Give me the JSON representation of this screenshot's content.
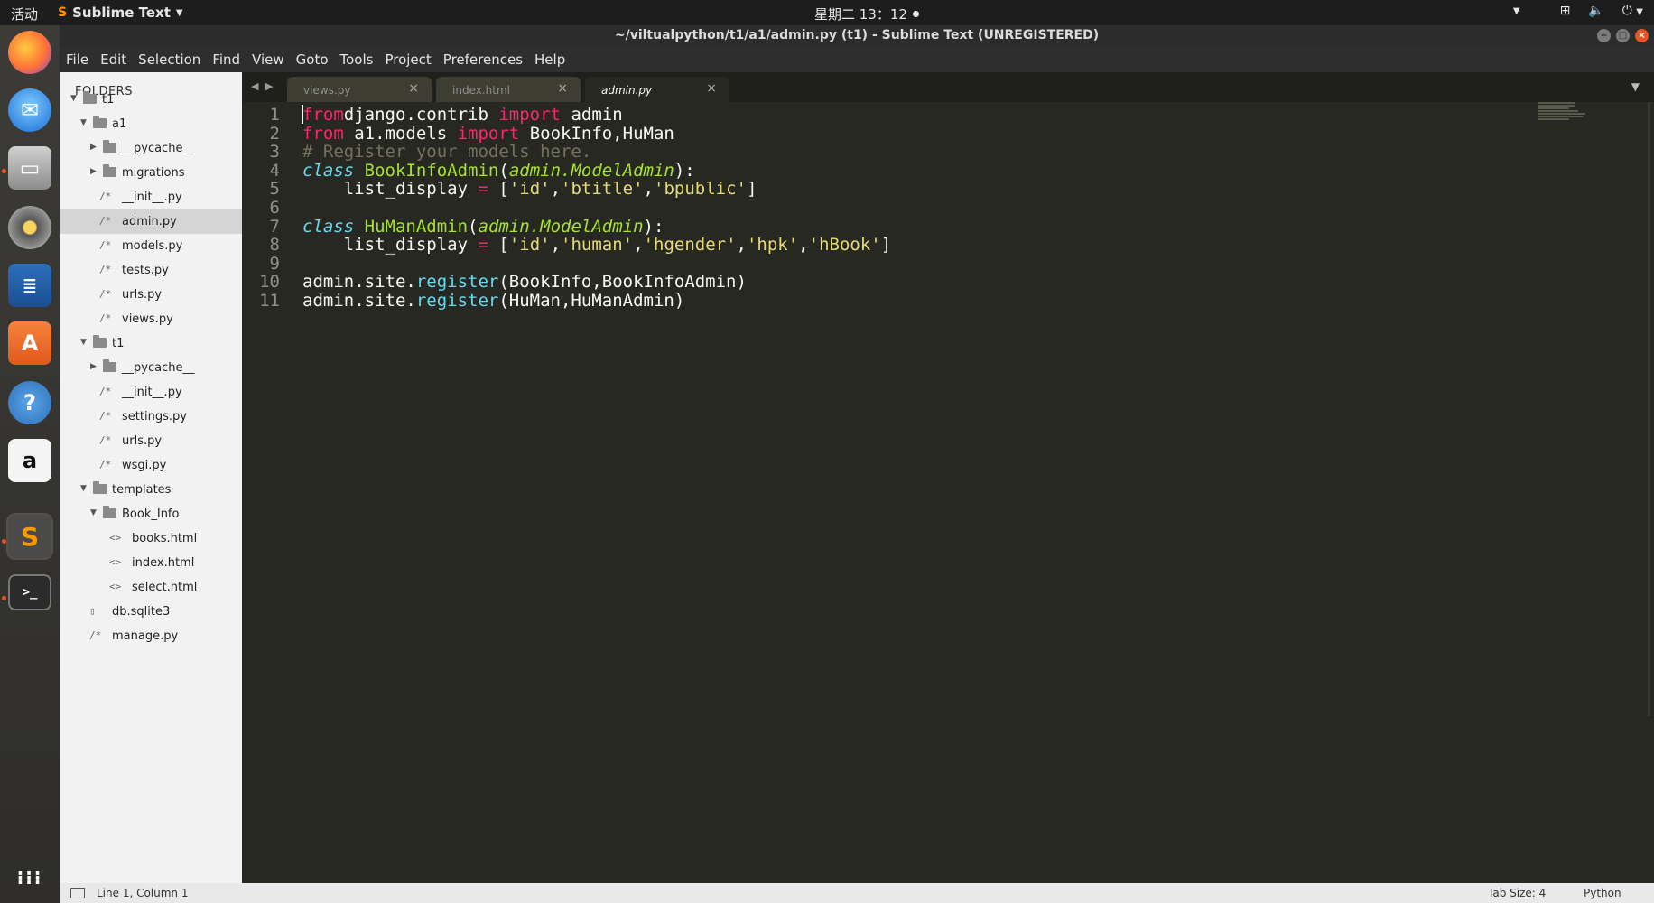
{
  "topbar": {
    "activities": "活动",
    "app_name": "Sublime Text",
    "clock": "星期二 13：12"
  },
  "dock": {
    "items": [
      "firefox-icon",
      "thunderbird-icon",
      "files-icon",
      "rhythmbox-icon",
      "writer-icon",
      "software-icon",
      "help-icon",
      "amazon-icon",
      "sublime-icon",
      "terminal-icon",
      "app-grid-icon"
    ]
  },
  "window": {
    "title": "~/viltualpython/t1/a1/admin.py (t1) - Sublime Text (UNREGISTERED)"
  },
  "menu": {
    "items": [
      "File",
      "Edit",
      "Selection",
      "Find",
      "View",
      "Goto",
      "Tools",
      "Project",
      "Preferences",
      "Help"
    ]
  },
  "sidebar": {
    "header": "FOLDERS",
    "tree": [
      {
        "label": "t1",
        "kind": "folder-open",
        "depth": 0
      },
      {
        "label": "a1",
        "kind": "folder-open",
        "depth": 1
      },
      {
        "label": "__pycache__",
        "kind": "folder",
        "depth": 2
      },
      {
        "label": "migrations",
        "kind": "folder",
        "depth": 2
      },
      {
        "label": "__init__.py",
        "kind": "py",
        "depth": 2
      },
      {
        "label": "admin.py",
        "kind": "py",
        "depth": 2,
        "selected": true
      },
      {
        "label": "models.py",
        "kind": "py",
        "depth": 2
      },
      {
        "label": "tests.py",
        "kind": "py",
        "depth": 2
      },
      {
        "label": "urls.py",
        "kind": "py",
        "depth": 2
      },
      {
        "label": "views.py",
        "kind": "py",
        "depth": 2
      },
      {
        "label": "t1",
        "kind": "folder-open",
        "depth": 1
      },
      {
        "label": "__pycache__",
        "kind": "folder",
        "depth": 2
      },
      {
        "label": "__init__.py",
        "kind": "py",
        "depth": 2
      },
      {
        "label": "settings.py",
        "kind": "py",
        "depth": 2
      },
      {
        "label": "urls.py",
        "kind": "py",
        "depth": 2
      },
      {
        "label": "wsgi.py",
        "kind": "py",
        "depth": 2
      },
      {
        "label": "templates",
        "kind": "folder-open",
        "depth": 1
      },
      {
        "label": "Book_Info",
        "kind": "folder-open",
        "depth": 2
      },
      {
        "label": "books.html",
        "kind": "html",
        "depth": 3
      },
      {
        "label": "index.html",
        "kind": "html",
        "depth": 3
      },
      {
        "label": "select.html",
        "kind": "html",
        "depth": 3
      },
      {
        "label": "db.sqlite3",
        "kind": "file",
        "depth": 1
      },
      {
        "label": "manage.py",
        "kind": "py",
        "depth": 1
      }
    ]
  },
  "tabs": [
    {
      "label": "views.py",
      "active": false
    },
    {
      "label": "index.html",
      "active": false
    },
    {
      "label": "admin.py",
      "active": true
    }
  ],
  "editor": {
    "lines": [
      [
        [
          "kw",
          "from"
        ],
        [
          "",
          "django.contrib "
        ],
        [
          "kw",
          "import"
        ],
        [
          "",
          " admin"
        ]
      ],
      [
        [
          "kw",
          "from"
        ],
        [
          "",
          " a1.models "
        ],
        [
          "kw",
          "import"
        ],
        [
          "",
          " BookInfo,HuMan"
        ]
      ],
      [
        [
          "cmt",
          "# Register your models here."
        ]
      ],
      [
        [
          "cls",
          "class"
        ],
        [
          "",
          " "
        ],
        [
          "ent",
          "BookInfoAdmin"
        ],
        [
          "",
          "("
        ],
        [
          "inh",
          "admin.ModelAdmin"
        ],
        [
          "",
          "):"
        ]
      ],
      [
        [
          "",
          "    list_display "
        ],
        [
          "kw",
          "="
        ],
        [
          "",
          " ["
        ],
        [
          "str",
          "'id'"
        ],
        [
          "",
          ","
        ],
        [
          "str",
          "'btitle'"
        ],
        [
          "",
          ","
        ],
        [
          "str",
          "'bpublic'"
        ],
        [
          "",
          "]"
        ]
      ],
      [],
      [
        [
          "cls",
          "class"
        ],
        [
          "",
          " "
        ],
        [
          "ent",
          "HuManAdmin"
        ],
        [
          "",
          "("
        ],
        [
          "inh",
          "admin.ModelAdmin"
        ],
        [
          "",
          "):"
        ]
      ],
      [
        [
          "",
          "    list_display "
        ],
        [
          "kw",
          "="
        ],
        [
          "",
          " ["
        ],
        [
          "str",
          "'id'"
        ],
        [
          "",
          ","
        ],
        [
          "str",
          "'human'"
        ],
        [
          "",
          ","
        ],
        [
          "str",
          "'hgender'"
        ],
        [
          "",
          ","
        ],
        [
          "str",
          "'hpk'"
        ],
        [
          "",
          ","
        ],
        [
          "str",
          "'hBook'"
        ],
        [
          "",
          "]"
        ]
      ],
      [],
      [
        [
          "",
          "admin.site."
        ],
        [
          "fn",
          "register"
        ],
        [
          "",
          "(BookInfo,BookInfoAdmin)"
        ]
      ],
      [
        [
          "",
          "admin.site."
        ],
        [
          "fn",
          "register"
        ],
        [
          "",
          "(HuMan,HuManAdmin)"
        ]
      ]
    ]
  },
  "status": {
    "position": "Line 1, Column 1",
    "tab_size": "Tab Size: 4",
    "syntax": "Python"
  },
  "colors": {
    "editor_bg": "#272822",
    "keyword": "#f92672",
    "string": "#e6db74",
    "entity": "#a6e22e",
    "storage": "#66d9ef",
    "comment": "#75715e",
    "ubuntu_orange": "#e95420"
  }
}
